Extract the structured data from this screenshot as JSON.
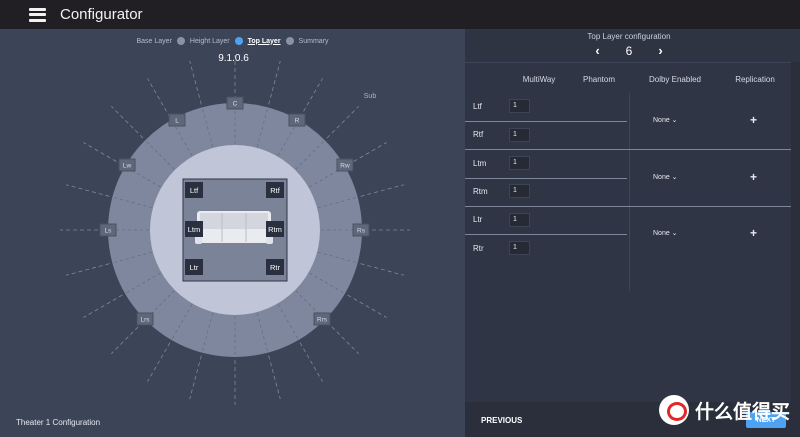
{
  "app": {
    "title": "Configurator"
  },
  "stepper": {
    "steps": [
      "Base Layer",
      "Height Layer",
      "Top Layer",
      "Summary"
    ],
    "active": "Top Layer"
  },
  "layout": {
    "format": "9.1.0.6",
    "footer": "Theater 1 Configuration",
    "sub_label": "Sub",
    "ring_speakers": [
      "C",
      "L",
      "R",
      "Lw",
      "Rw",
      "Ls",
      "Rs",
      "Lrs",
      "Rrs"
    ],
    "top_speakers": [
      "Ltf",
      "Rtf",
      "Ltm",
      "Rtm",
      "Ltr",
      "Rtr"
    ]
  },
  "config": {
    "title": "Top Layer configuration",
    "count": "6",
    "prev_icon": "chevron-left-icon",
    "next_icon": "chevron-right-icon",
    "columns": [
      "MultiWay",
      "Phantom",
      "Dolby Enabled",
      "Replication"
    ],
    "rows": [
      {
        "name": "Ltf",
        "multiway": "1"
      },
      {
        "name": "Rtf",
        "multiway": "1"
      },
      {
        "name": "Ltm",
        "multiway": "1"
      },
      {
        "name": "Rtm",
        "multiway": "1"
      },
      {
        "name": "Ltr",
        "multiway": "1"
      },
      {
        "name": "Rtr",
        "multiway": "1"
      }
    ],
    "groups": [
      {
        "dolby": "None",
        "replication_icon": "plus-icon"
      },
      {
        "dolby": "None",
        "replication_icon": "plus-icon"
      },
      {
        "dolby": "None",
        "replication_icon": "plus-icon"
      }
    ]
  },
  "nav": {
    "previous": "PREVIOUS",
    "next": "NEXT"
  },
  "watermark": {
    "text": "什么值得买",
    "icon": "smzdm-logo-icon"
  },
  "colors": {
    "accent": "#4da3f2",
    "panel": "#3c4457",
    "topbar": "#221f24"
  }
}
